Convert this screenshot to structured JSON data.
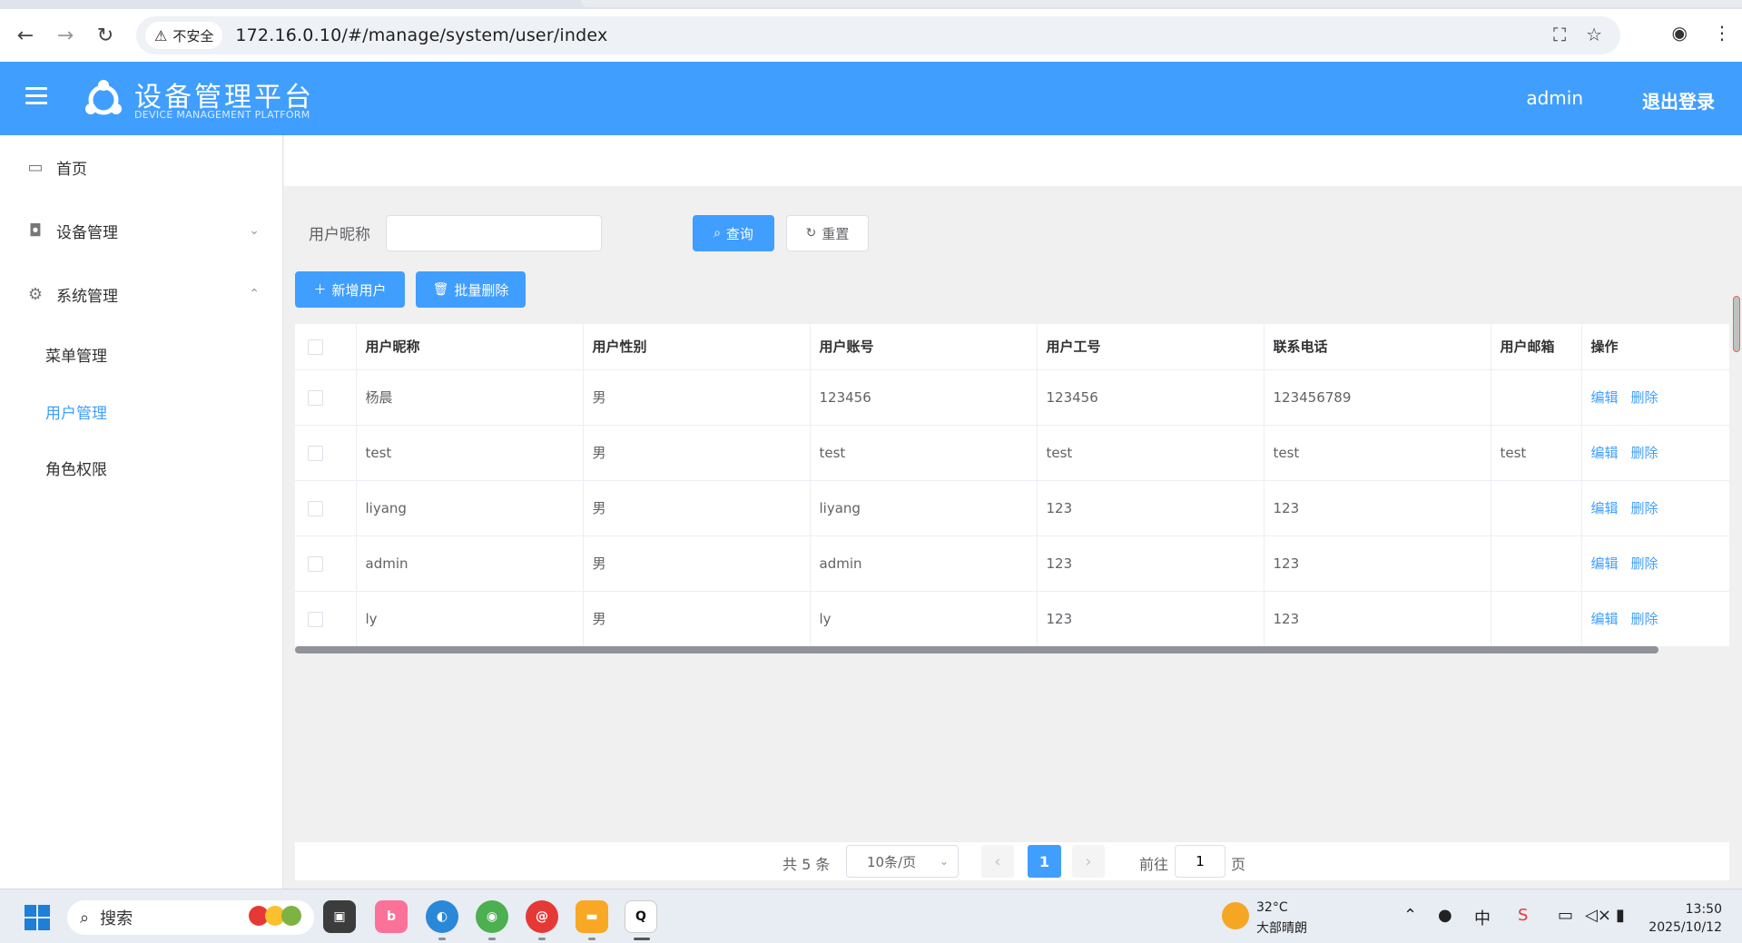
{
  "browser": {
    "security_label": "不安全",
    "url": "172.16.0.10/#/manage/system/user/index"
  },
  "header": {
    "title": "设备管理平台",
    "subtitle": "DEVICE MANAGEMENT PLATFORM",
    "user": "admin",
    "logout": "退出登录"
  },
  "sidebar": {
    "home": "首页",
    "device": "设备管理",
    "system": "系统管理",
    "menu_mgmt": "菜单管理",
    "user_mgmt": "用户管理",
    "role_perm": "角色权限"
  },
  "filter": {
    "label": "用户昵称",
    "value": "",
    "search_btn": "查询",
    "reset_btn": "重置"
  },
  "toolbar": {
    "add_btn": "新增用户",
    "batch_delete_btn": "批量删除"
  },
  "table": {
    "headers": [
      "用户昵称",
      "用户性别",
      "用户账号",
      "用户工号",
      "联系电话",
      "用户邮箱",
      "操作"
    ],
    "rows": [
      [
        "杨晨",
        "男",
        "123456",
        "123456",
        "123456789",
        ""
      ],
      [
        "test",
        "男",
        "test",
        "test",
        "test",
        "test"
      ],
      [
        "liyang",
        "男",
        "liyang",
        "123",
        "123",
        ""
      ],
      [
        "admin",
        "男",
        "admin",
        "123",
        "123",
        ""
      ],
      [
        "ly",
        "男",
        "ly",
        "123",
        "123",
        ""
      ]
    ],
    "edit_label": "编辑",
    "delete_label": "删除"
  },
  "pagination": {
    "total": "共 5 条",
    "page_size": "10条/页",
    "current_page": "1",
    "goto_label": "前往",
    "goto_value": "1",
    "page_unit": "页"
  },
  "taskbar": {
    "search_placeholder": "搜索",
    "weather_temp": "32°C",
    "weather_desc": "大部晴朗",
    "time": "13:50",
    "date": "2025/10/12"
  },
  "colors": {
    "primary": "#409eff",
    "header_bg": "#409eff"
  }
}
